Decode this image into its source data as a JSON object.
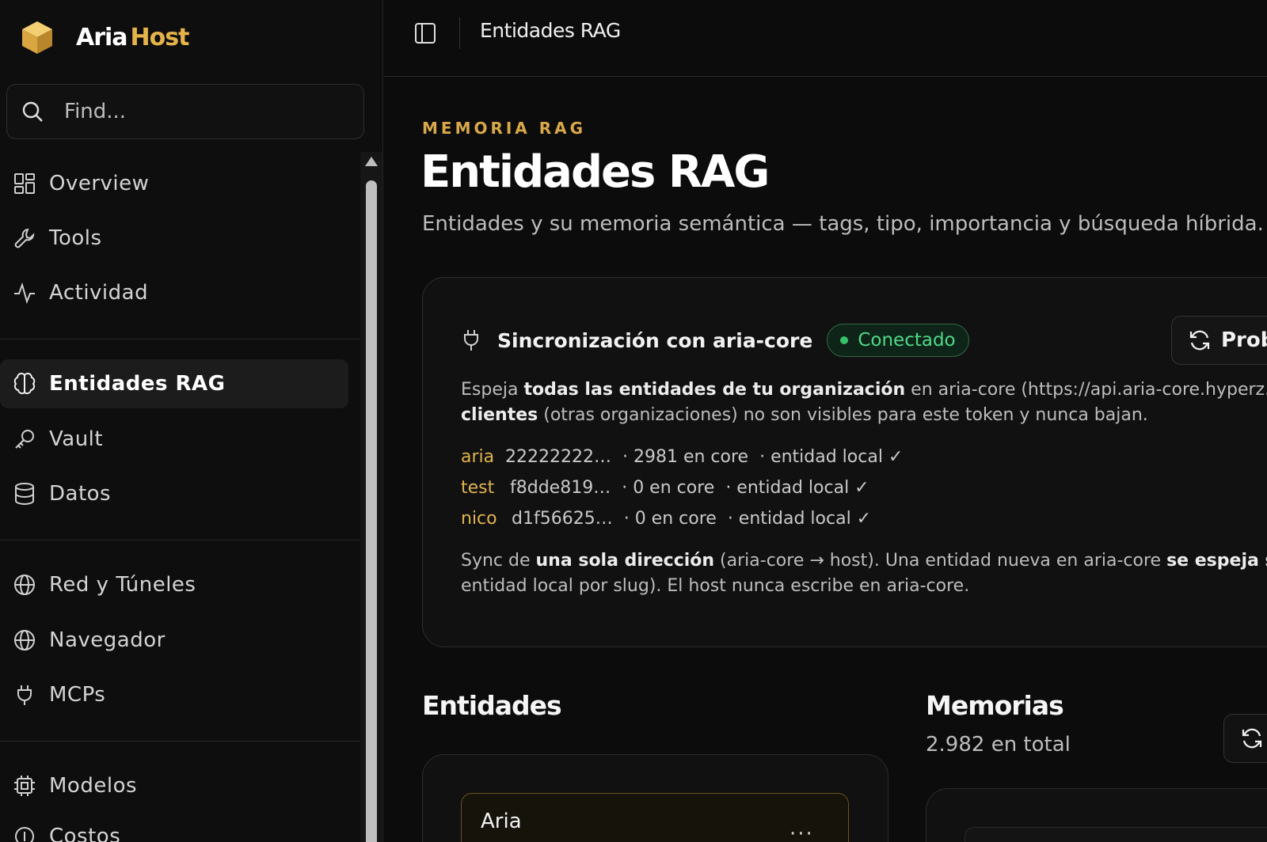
{
  "brand": {
    "name_part1": "Aria",
    "name_part2": "Host"
  },
  "search": {
    "placeholder": "Find..."
  },
  "sidebar": {
    "items": [
      {
        "label": "Overview",
        "icon": "layout-dashboard-icon"
      },
      {
        "label": "Tools",
        "icon": "wrench-icon"
      },
      {
        "label": "Actividad",
        "icon": "activity-icon"
      },
      {
        "label": "Entidades RAG",
        "icon": "brain-icon",
        "active": true
      },
      {
        "label": "Vault",
        "icon": "key-icon"
      },
      {
        "label": "Datos",
        "icon": "database-icon"
      },
      {
        "label": "Red y Túneles",
        "icon": "globe-icon"
      },
      {
        "label": "Navegador",
        "icon": "globe-icon"
      },
      {
        "label": "MCPs",
        "icon": "plug-icon"
      },
      {
        "label": "Modelos",
        "icon": "cpu-icon"
      },
      {
        "label": "Costos",
        "icon": "coins-icon"
      }
    ]
  },
  "topbar": {
    "title": "Entidades RAG"
  },
  "page": {
    "eyebrow": "MEMORIA RAG",
    "title": "Entidades RAG",
    "subtitle": "Entidades y su memoria semántica — tags, tipo, importancia y búsqueda híbrida."
  },
  "sync": {
    "title": "Sincronización con aria-core",
    "status": "Conectado",
    "probe_label": "Prob",
    "desc": {
      "t1": "Espeja ",
      "b1": "todas las entidades de tu organización",
      "t2": " en aria-core (https://api.aria-core.hyperz.te",
      "b2": "clientes",
      "t3": " (otras organizaciones) no son visibles para este token y nunca bajan."
    },
    "entities": [
      {
        "slug": "aria",
        "id": "22222222…",
        "count": "· 2981 en core",
        "local": "· entidad local ✓"
      },
      {
        "slug": "test",
        "id": "f8dde819…",
        "count": "· 0 en core",
        "local": "· entidad local ✓"
      },
      {
        "slug": "nico",
        "id": "d1f56625…",
        "count": "· 0 en core",
        "local": "· entidad local ✓"
      }
    ],
    "foot": {
      "t1": "Sync de ",
      "b1": "una sola dirección",
      "t2": " (aria-core → host). Una entidad nueva en aria-core ",
      "b2": "se espeja s",
      "t3": "entidad local por slug). El host nunca escribe en aria-core."
    }
  },
  "entities_section": {
    "title": "Entidades",
    "card_name": "Aria",
    "card_more": "···"
  },
  "memories_section": {
    "title": "Memorias",
    "total": "2.982 en total"
  },
  "colors": {
    "accent": "#e6b34a",
    "success": "#37c16a",
    "background": "#0c0c0c"
  }
}
